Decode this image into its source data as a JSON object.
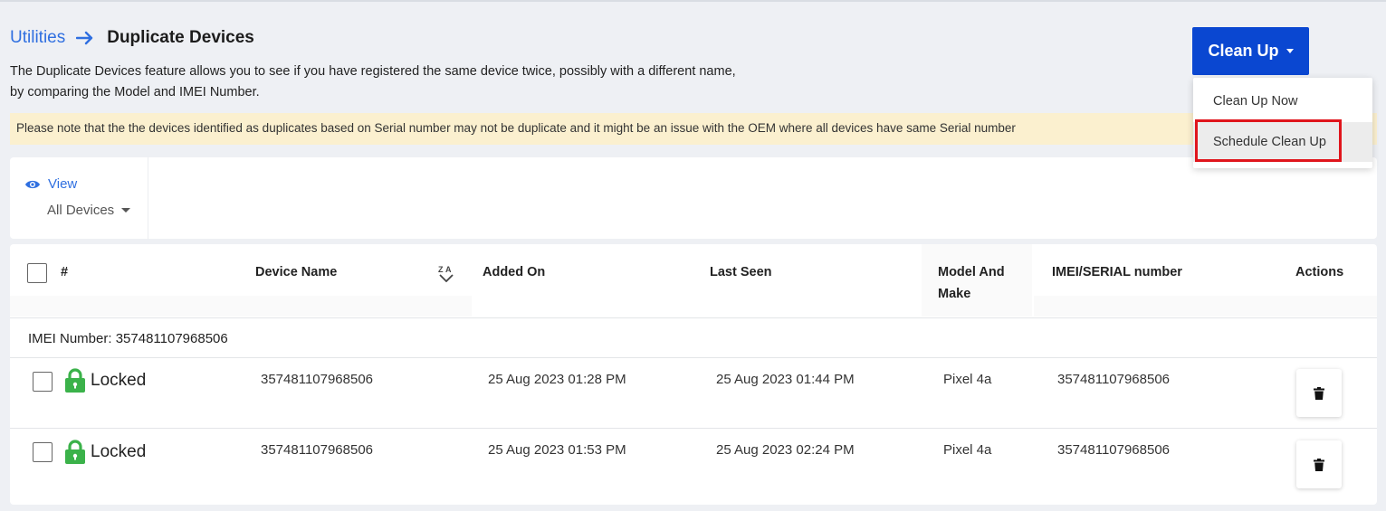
{
  "breadcrumb": {
    "parent": "Utilities",
    "current": "Duplicate Devices"
  },
  "description": {
    "line1": "The Duplicate Devices feature allows you to see if you have registered the same device twice, possibly with a different name,",
    "line2": "by comparing the Model and IMEI Number."
  },
  "note": "Please note that the the devices identified as duplicates based on Serial number may not be duplicate and it might be an issue with the OEM where all devices have same Serial number",
  "cleanup": {
    "button_label": "Clean Up",
    "menu": [
      "Clean Up Now",
      "Schedule Clean Up"
    ],
    "highlighted_item": "Schedule Clean Up",
    "highlight_color": "#e0151c"
  },
  "view": {
    "label": "View",
    "selected": "All Devices"
  },
  "table": {
    "headers": {
      "index": "#",
      "device_name": "Device Name",
      "added_on": "Added On",
      "last_seen": "Last Seen",
      "model_line1": "Model And",
      "model_line2": "Make",
      "imei": "IMEI/SERIAL number",
      "actions": "Actions"
    },
    "sort_icon": "sort-z-a-icon",
    "group_prefix": "IMEI Number:",
    "group_value": "357481107968506",
    "rows": [
      {
        "status": "Locked",
        "device_name": "357481107968506",
        "added_on": "25 Aug 2023 01:28 PM",
        "last_seen": "25 Aug 2023 01:44 PM",
        "model": "Pixel 4a",
        "imei": "357481107968506"
      },
      {
        "status": "Locked",
        "device_name": "357481107968506",
        "added_on": "25 Aug 2023 01:53 PM",
        "last_seen": "25 Aug 2023 02:24 PM",
        "model": "Pixel 4a",
        "imei": "357481107968506"
      }
    ]
  },
  "colors": {
    "primary": "#0a47d1",
    "link": "#2f6fe0",
    "lock_green": "#3bb24a",
    "note_bg": "#fbf0cf"
  }
}
